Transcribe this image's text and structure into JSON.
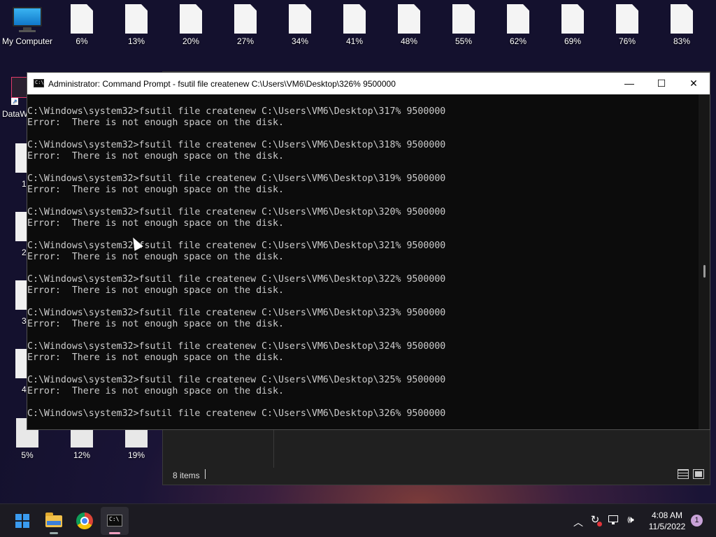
{
  "desktop": {
    "top_icons": [
      {
        "label": "My Computer",
        "kind": "monitor"
      },
      {
        "label": "6%",
        "kind": "file"
      },
      {
        "label": "13%",
        "kind": "file"
      },
      {
        "label": "20%",
        "kind": "file"
      },
      {
        "label": "27%",
        "kind": "file"
      },
      {
        "label": "34%",
        "kind": "file"
      },
      {
        "label": "41%",
        "kind": "file"
      },
      {
        "label": "48%",
        "kind": "file"
      },
      {
        "label": "55%",
        "kind": "file"
      },
      {
        "label": "62%",
        "kind": "file"
      },
      {
        "label": "69%",
        "kind": "file"
      },
      {
        "label": "76%",
        "kind": "file"
      },
      {
        "label": "83%",
        "kind": "file"
      }
    ],
    "left_column": {
      "app_label": "DataW",
      "partial_labels": [
        "1",
        "2",
        "3",
        "4"
      ]
    },
    "bottom_icons": [
      {
        "label": "5%"
      },
      {
        "label": "12%"
      },
      {
        "label": "19%"
      }
    ]
  },
  "explorer": {
    "status_text": "8 items"
  },
  "cmd": {
    "title": "Administrator: Command Prompt - fsutil  file createnew C:\\Users\\VM6\\Desktop\\326% 9500000",
    "icon_text": "C:\\",
    "controls": {
      "minimize": "—",
      "maximize": "☐",
      "close": "✕"
    },
    "lines": [
      "C:\\Windows\\system32>fsutil file createnew C:\\Users\\VM6\\Desktop\\317% 9500000",
      "Error:  There is not enough space on the disk.",
      "",
      "C:\\Windows\\system32>fsutil file createnew C:\\Users\\VM6\\Desktop\\318% 9500000",
      "Error:  There is not enough space on the disk.",
      "",
      "C:\\Windows\\system32>fsutil file createnew C:\\Users\\VM6\\Desktop\\319% 9500000",
      "Error:  There is not enough space on the disk.",
      "",
      "C:\\Windows\\system32>fsutil file createnew C:\\Users\\VM6\\Desktop\\320% 9500000",
      "Error:  There is not enough space on the disk.",
      "",
      "C:\\Windows\\system32>fsutil file createnew C:\\Users\\VM6\\Desktop\\321% 9500000",
      "Error:  There is not enough space on the disk.",
      "",
      "C:\\Windows\\system32>fsutil file createnew C:\\Users\\VM6\\Desktop\\322% 9500000",
      "Error:  There is not enough space on the disk.",
      "",
      "C:\\Windows\\system32>fsutil file createnew C:\\Users\\VM6\\Desktop\\323% 9500000",
      "Error:  There is not enough space on the disk.",
      "",
      "C:\\Windows\\system32>fsutil file createnew C:\\Users\\VM6\\Desktop\\324% 9500000",
      "Error:  There is not enough space on the disk.",
      "",
      "C:\\Windows\\system32>fsutil file createnew C:\\Users\\VM6\\Desktop\\325% 9500000",
      "Error:  There is not enough space on the disk.",
      "",
      "C:\\Windows\\system32>fsutil file createnew C:\\Users\\VM6\\Desktop\\326% 9500000"
    ]
  },
  "taskbar": {
    "apps": [
      {
        "name": "start",
        "icon": "windows-start-icon"
      },
      {
        "name": "file-explorer",
        "icon": "folder-icon"
      },
      {
        "name": "chrome",
        "icon": "chrome-icon"
      },
      {
        "name": "terminal",
        "icon": "terminal-icon"
      }
    ],
    "clock_time": "4:08 AM",
    "clock_date": "11/5/2022",
    "notification_count": "1",
    "colors": {
      "accent": "#3a9bf0",
      "taskbar_bg": "#1c1b22"
    }
  }
}
